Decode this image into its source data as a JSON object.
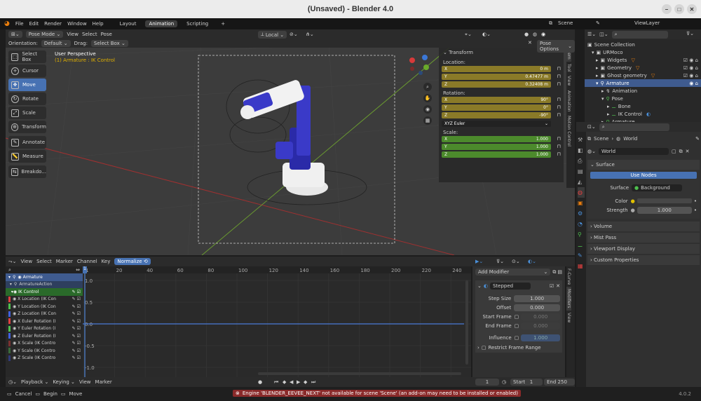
{
  "window": {
    "title": "(Unsaved) - Blender 4.0"
  },
  "menu": {
    "items": [
      "File",
      "Edit",
      "Render",
      "Window",
      "Help"
    ],
    "tabs": [
      "Layout",
      "Animation",
      "Scripting",
      "+"
    ],
    "scene": "Scene",
    "view_layer": "ViewLayer"
  },
  "viewport_header": {
    "mode": "Pose Mode",
    "menus": [
      "View",
      "Select",
      "Pose"
    ],
    "transform_space": "Local",
    "orientation_label": "Orientation:",
    "orientation_value": "Default",
    "drag_label": "Drag:",
    "drag_value": "Select Box",
    "options": "Pose Options"
  },
  "viewport": {
    "perspective": "User Perspective",
    "object": "(1) Armature : IK Control"
  },
  "toolbar": {
    "tools": [
      "Select Box",
      "Cursor",
      "Move",
      "Rotate",
      "Scale",
      "Transform",
      "Annotate",
      "Measure",
      "Breakdo..."
    ]
  },
  "transform": {
    "title": "Transform",
    "location_label": "Location:",
    "location": [
      {
        "axis": "X",
        "value": "0 m"
      },
      {
        "axis": "Y",
        "value": "0.47477 m"
      },
      {
        "axis": "Z",
        "value": "0.32408 m"
      }
    ],
    "rotation_label": "Rotation:",
    "rotation": [
      {
        "axis": "X",
        "value": "90°"
      },
      {
        "axis": "Y",
        "value": "0°"
      },
      {
        "axis": "Z",
        "value": "-90°"
      }
    ],
    "rotation_mode": "XYZ Euler",
    "scale_label": "Scale:",
    "scale": [
      {
        "axis": "X",
        "value": "1.000"
      },
      {
        "axis": "Y",
        "value": "1.000"
      },
      {
        "axis": "Z",
        "value": "1.000"
      }
    ]
  },
  "side_tabs": [
    "Item",
    "Tool",
    "View",
    "Animation",
    "Motion Control"
  ],
  "outliner": {
    "rows": [
      "Scene Collection",
      "URMoco",
      "Widgets",
      "Geometry",
      "Ghost geometry",
      "Armature",
      "Animation",
      "Pose",
      "Bone",
      "IK Control",
      "Armature"
    ]
  },
  "properties": {
    "breadcrumb_scene": "Scene",
    "breadcrumb_world": "World",
    "world_name": "World",
    "surface_title": "Surface",
    "use_nodes": "Use Nodes",
    "surface_label": "Surface",
    "surface_value": "Background",
    "color_label": "Color",
    "strength_label": "Strength",
    "strength_value": "1.000",
    "sections": [
      "Volume",
      "Mist Pass",
      "Viewport Display",
      "Custom Properties"
    ]
  },
  "graph_header": {
    "menus": [
      "View",
      "Select",
      "Marker",
      "Channel",
      "Key"
    ],
    "normalize": "Normalize"
  },
  "graph": {
    "frame_ticks": [
      "1",
      "20",
      "40",
      "60",
      "80",
      "100",
      "120",
      "140",
      "160",
      "180",
      "200",
      "220",
      "240"
    ],
    "value_ticks": [
      "1.0",
      "0.5",
      "0.0",
      "-0.5",
      "-1.0"
    ],
    "current_frame": "1"
  },
  "channels": {
    "armature": "Armature",
    "action": "ArmatureAction",
    "group": "IK Control",
    "rows": [
      {
        "name": "X Location (IK Con",
        "color": "#e04040"
      },
      {
        "name": "Y Location (IK Con",
        "color": "#4ec04e"
      },
      {
        "name": "Z Location (IK Con",
        "color": "#4060e0"
      },
      {
        "name": "X Euler Rotation (I",
        "color": "#e04040"
      },
      {
        "name": "Y Euler Rotation (I",
        "color": "#4ec04e"
      },
      {
        "name": "Z Euler Rotation (I",
        "color": "#4060e0"
      },
      {
        "name": "X Scale (IK Contro",
        "color": "#7a3030"
      },
      {
        "name": "Y Scale (IK Contro",
        "color": "#3a6a3a"
      },
      {
        "name": "Z Scale (IK Contro",
        "color": "#303a7a"
      }
    ]
  },
  "modifier": {
    "add_label": "Add Modifier",
    "name": "Stepped",
    "step_size_label": "Step Size",
    "step_size": "1.000",
    "offset_label": "Offset",
    "offset": "0.000",
    "start_frame_label": "Start Frame",
    "start_frame": "0.000",
    "end_frame_label": "End Frame",
    "end_frame": "0.000",
    "influence_label": "Influence",
    "influence": "1.000",
    "restrict_label": "Restrict Frame Range",
    "tabs": [
      "F-Curve",
      "Modifiers",
      "View"
    ]
  },
  "timeline": {
    "menus": [
      "Playback",
      "Keying",
      "View",
      "Marker"
    ],
    "frame": "1",
    "start_label": "Start",
    "start": "1",
    "end_label": "End",
    "end": "250"
  },
  "status": {
    "cancel": "Cancel",
    "begin": "Begin",
    "move": "Move",
    "warning": "Engine 'BLENDER_EEVEE_NEXT' not available for scene 'Scene' (an add-on may need to be installed or enabled)",
    "version": "4.0.2"
  }
}
